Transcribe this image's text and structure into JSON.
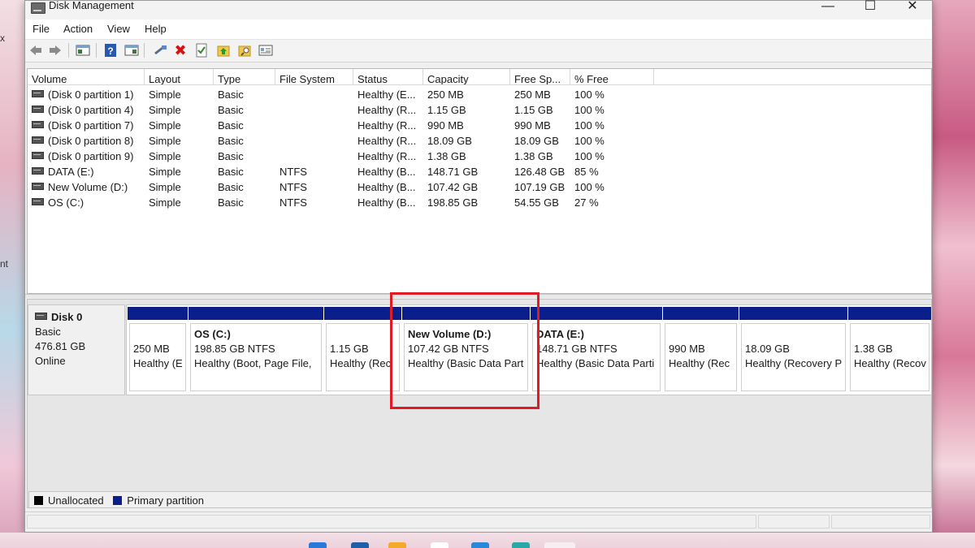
{
  "window": {
    "title": "Disk Management",
    "controls": {
      "minimize": "—",
      "maximize": "☐",
      "close": "✕"
    }
  },
  "desktop": {
    "left_fragment_1": "x",
    "left_fragment_2": "nt"
  },
  "menu": [
    "File",
    "Action",
    "View",
    "Help"
  ],
  "toolbar": {
    "icons": [
      "back-arrow-icon",
      "forward-arrow-icon",
      "console-tree-icon",
      "help-icon",
      "properties-pane-icon",
      "connect-icon",
      "delete-icon",
      "check-icon",
      "folder-up-icon",
      "search-folder-icon",
      "list-icon"
    ]
  },
  "volume_list": {
    "columns": [
      "Volume",
      "Layout",
      "Type",
      "File System",
      "Status",
      "Capacity",
      "Free Sp...",
      "% Free"
    ],
    "rows": [
      {
        "volume": "(Disk 0 partition 1)",
        "layout": "Simple",
        "type": "Basic",
        "fs": "",
        "status": "Healthy (E...",
        "capacity": "250 MB",
        "free": "250 MB",
        "pct": "100 %"
      },
      {
        "volume": "(Disk 0 partition 4)",
        "layout": "Simple",
        "type": "Basic",
        "fs": "",
        "status": "Healthy (R...",
        "capacity": "1.15 GB",
        "free": "1.15 GB",
        "pct": "100 %"
      },
      {
        "volume": "(Disk 0 partition 7)",
        "layout": "Simple",
        "type": "Basic",
        "fs": "",
        "status": "Healthy (R...",
        "capacity": "990 MB",
        "free": "990 MB",
        "pct": "100 %"
      },
      {
        "volume": "(Disk 0 partition 8)",
        "layout": "Simple",
        "type": "Basic",
        "fs": "",
        "status": "Healthy (R...",
        "capacity": "18.09 GB",
        "free": "18.09 GB",
        "pct": "100 %"
      },
      {
        "volume": "(Disk 0 partition 9)",
        "layout": "Simple",
        "type": "Basic",
        "fs": "",
        "status": "Healthy (R...",
        "capacity": "1.38 GB",
        "free": "1.38 GB",
        "pct": "100 %"
      },
      {
        "volume": "DATA (E:)",
        "layout": "Simple",
        "type": "Basic",
        "fs": "NTFS",
        "status": "Healthy (B...",
        "capacity": "148.71 GB",
        "free": "126.48 GB",
        "pct": "85 %"
      },
      {
        "volume": "New Volume (D:)",
        "layout": "Simple",
        "type": "Basic",
        "fs": "NTFS",
        "status": "Healthy (B...",
        "capacity": "107.42 GB",
        "free": "107.19 GB",
        "pct": "100 %"
      },
      {
        "volume": "OS (C:)",
        "layout": "Simple",
        "type": "Basic",
        "fs": "NTFS",
        "status": "Healthy (B...",
        "capacity": "198.85 GB",
        "free": "54.55 GB",
        "pct": "27 %"
      }
    ]
  },
  "disk": {
    "name": "Disk 0",
    "kind": "Basic",
    "size": "476.81 GB",
    "state": "Online",
    "partitions": [
      {
        "name": "",
        "size": "250 MB",
        "status": "Healthy (E"
      },
      {
        "name": "OS  (C:)",
        "size": "198.85 GB NTFS",
        "status": "Healthy (Boot, Page File,"
      },
      {
        "name": "",
        "size": "1.15 GB",
        "status": "Healthy (Rec"
      },
      {
        "name": "New Volume  (D:)",
        "size": "107.42 GB NTFS",
        "status": "Healthy (Basic Data Part"
      },
      {
        "name": "DATA  (E:)",
        "size": "148.71 GB NTFS",
        "status": "Healthy (Basic Data Parti"
      },
      {
        "name": "",
        "size": "990 MB",
        "status": "Healthy (Rec"
      },
      {
        "name": "",
        "size": "18.09 GB",
        "status": "Healthy (Recovery P"
      },
      {
        "name": "",
        "size": "1.38 GB",
        "status": "Healthy (Recov"
      }
    ]
  },
  "legend": [
    {
      "label": "Unallocated",
      "color": "#000000"
    },
    {
      "label": "Primary partition",
      "color": "#0a1f8c"
    }
  ],
  "colors": {
    "partition_bar": "#0a1f8c",
    "highlight": "#e01b24"
  }
}
